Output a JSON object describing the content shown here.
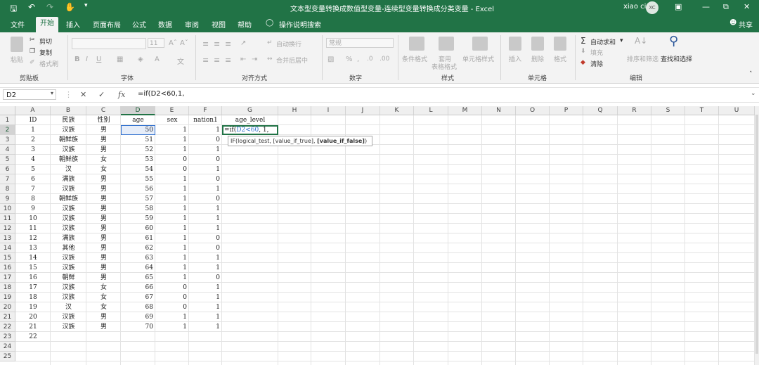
{
  "window": {
    "title": "文本型变量转换成数值型变量-连续型变量转换成分类变量 - Excel",
    "user": "xiao ci",
    "avatar": "XC"
  },
  "tabs": [
    {
      "label": "文件"
    },
    {
      "label": "开始"
    },
    {
      "label": "插入"
    },
    {
      "label": "页面布局"
    },
    {
      "label": "公式"
    },
    {
      "label": "数据"
    },
    {
      "label": "审阅"
    },
    {
      "label": "视图"
    },
    {
      "label": "帮助"
    },
    {
      "label": "操作说明搜索"
    }
  ],
  "share_label": "共享",
  "ribbon": {
    "clipboard": {
      "paste": "粘贴",
      "cut": "剪切",
      "copy": "复制",
      "format_painter": "格式刷",
      "label": "剪贴板"
    },
    "font": {
      "label": "字体",
      "size": "11"
    },
    "alignment": {
      "wrap": "自动换行",
      "merge": "合并后居中",
      "label": "对齐方式"
    },
    "number": {
      "format": "常规",
      "label": "数字"
    },
    "styles": {
      "cond": "条件格式",
      "table": "套用",
      "table2": "表格格式",
      "cell": "单元格样式",
      "label": "样式"
    },
    "cells": {
      "insert": "插入",
      "delete": "删除",
      "format": "格式",
      "label": "单元格"
    },
    "editing": {
      "autosum": "自动求和",
      "fill": "填充",
      "clear": "清除",
      "sort": "排序和筛选",
      "find": "查找和选择",
      "label": "编辑"
    }
  },
  "formula_bar": {
    "name_box": "D2",
    "fx": "fx",
    "formula": "=if(D2<60,1,"
  },
  "columns": [
    "A",
    "B",
    "C",
    "D",
    "E",
    "F",
    "G",
    "H",
    "I",
    "J",
    "K",
    "L",
    "M",
    "N",
    "O",
    "P",
    "Q",
    "R",
    "S",
    "T",
    "U"
  ],
  "headers": {
    "A": "ID",
    "B": "民族",
    "C": "性别",
    "D": "age",
    "E": "sex",
    "F": "nation1",
    "G": "age_level"
  },
  "rows": [
    {
      "id": "1",
      "mz": "汉族",
      "xb": "男",
      "age": "50",
      "sex": "1",
      "nation1": "1"
    },
    {
      "id": "2",
      "mz": "朝鲜族",
      "xb": "男",
      "age": "51",
      "sex": "1",
      "nation1": "0"
    },
    {
      "id": "3",
      "mz": "汉族",
      "xb": "男",
      "age": "52",
      "sex": "1",
      "nation1": "1"
    },
    {
      "id": "4",
      "mz": "朝鲜族",
      "xb": "女",
      "age": "53",
      "sex": "0",
      "nation1": "0"
    },
    {
      "id": "5",
      "mz": "汉",
      "xb": "女",
      "age": "54",
      "sex": "0",
      "nation1": "1"
    },
    {
      "id": "6",
      "mz": "满族",
      "xb": "男",
      "age": "55",
      "sex": "1",
      "nation1": "0"
    },
    {
      "id": "7",
      "mz": "汉族",
      "xb": "男",
      "age": "56",
      "sex": "1",
      "nation1": "1"
    },
    {
      "id": "8",
      "mz": "朝鲜族",
      "xb": "男",
      "age": "57",
      "sex": "1",
      "nation1": "0"
    },
    {
      "id": "9",
      "mz": "汉族",
      "xb": "男",
      "age": "58",
      "sex": "1",
      "nation1": "1"
    },
    {
      "id": "10",
      "mz": "汉族",
      "xb": "男",
      "age": "59",
      "sex": "1",
      "nation1": "1"
    },
    {
      "id": "11",
      "mz": "汉族",
      "xb": "男",
      "age": "60",
      "sex": "1",
      "nation1": "1"
    },
    {
      "id": "12",
      "mz": "满族",
      "xb": "男",
      "age": "61",
      "sex": "1",
      "nation1": "0"
    },
    {
      "id": "13",
      "mz": "其他",
      "xb": "男",
      "age": "62",
      "sex": "1",
      "nation1": "0"
    },
    {
      "id": "14",
      "mz": "汉族",
      "xb": "男",
      "age": "63",
      "sex": "1",
      "nation1": "1"
    },
    {
      "id": "15",
      "mz": "汉族",
      "xb": "男",
      "age": "64",
      "sex": "1",
      "nation1": "1"
    },
    {
      "id": "16",
      "mz": "朝鲜",
      "xb": "男",
      "age": "65",
      "sex": "1",
      "nation1": "0"
    },
    {
      "id": "17",
      "mz": "汉族",
      "xb": "女",
      "age": "66",
      "sex": "0",
      "nation1": "1"
    },
    {
      "id": "18",
      "mz": "汉族",
      "xb": "女",
      "age": "67",
      "sex": "0",
      "nation1": "1"
    },
    {
      "id": "19",
      "mz": "汉",
      "xb": "女",
      "age": "68",
      "sex": "0",
      "nation1": "1"
    },
    {
      "id": "20",
      "mz": "汉族",
      "xb": "男",
      "age": "69",
      "sex": "1",
      "nation1": "1"
    },
    {
      "id": "21",
      "mz": "汉族",
      "xb": "男",
      "age": "70",
      "sex": "1",
      "nation1": "1"
    },
    {
      "id": "22",
      "mz": "",
      "xb": "",
      "age": "",
      "sex": "",
      "nation1": ""
    }
  ],
  "active_cell": {
    "ref": "G2",
    "text": "=if(D2<60, 1,"
  },
  "tooltip": "IF(logical_test, [value_if_true], [value_if_false])",
  "row_count": 25,
  "colors": {
    "accent": "#217346",
    "reference": "#2f6fce"
  }
}
